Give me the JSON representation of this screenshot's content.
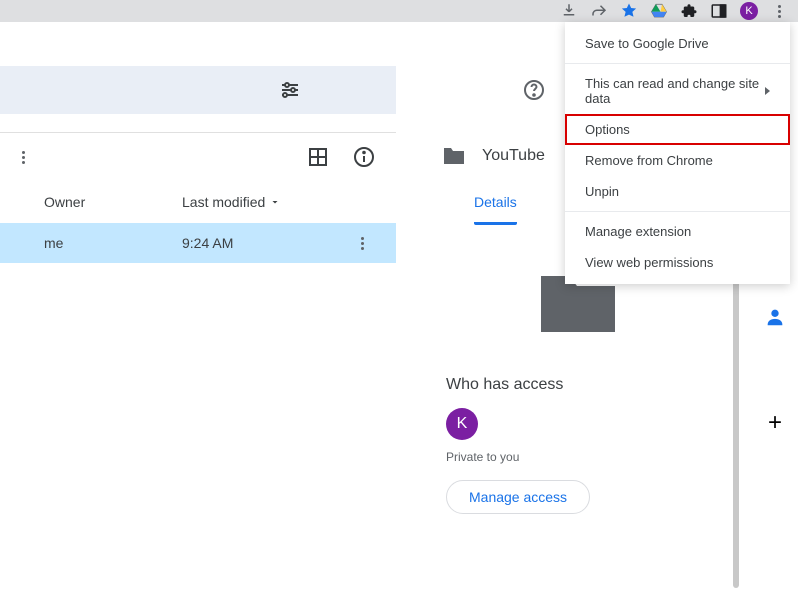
{
  "chrome_bar": {
    "avatar_letter": "K"
  },
  "ext_menu": {
    "save": "Save to Google Drive",
    "read_change": "This can read and change site data",
    "options": "Options",
    "remove": "Remove from Chrome",
    "unpin": "Unpin",
    "manage": "Manage extension",
    "permissions": "View web permissions"
  },
  "left": {
    "header": {
      "owner": "Owner",
      "modified": "Last modified"
    },
    "row": {
      "owner": "me",
      "modified": "9:24 AM"
    }
  },
  "right": {
    "title": "YouTube",
    "tab_details": "Details",
    "access_heading": "Who has access",
    "avatar_letter": "K",
    "private": "Private to you",
    "manage_access": "Manage access"
  }
}
